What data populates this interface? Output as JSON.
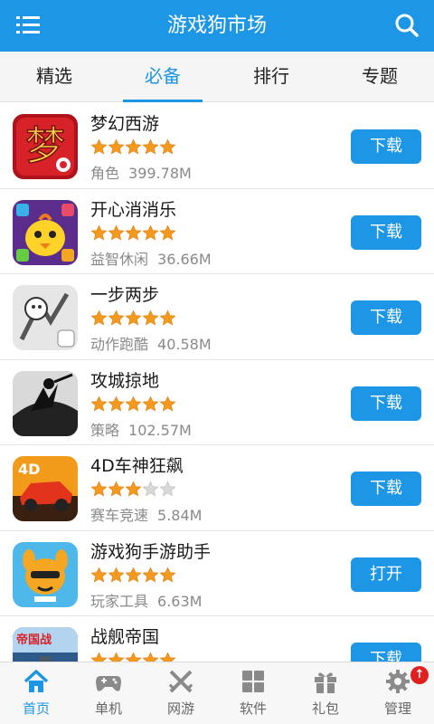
{
  "header": {
    "title": "游戏狗市场",
    "menu_icon": "menu-icon",
    "search_icon": "search-icon",
    "background": "#1e96e6"
  },
  "tabs": [
    {
      "label": "精选",
      "active": false
    },
    {
      "label": "必备",
      "active": true
    },
    {
      "label": "排行",
      "active": false
    },
    {
      "label": "专题",
      "active": false
    }
  ],
  "apps": [
    {
      "name": "梦幻西游",
      "rating": 5,
      "category": "角色",
      "size": "399.78M",
      "action": "下载",
      "icon": "menghuan-xiyou-icon"
    },
    {
      "name": "开心消消乐",
      "rating": 5,
      "category": "益智休闲",
      "size": "36.66M",
      "action": "下载",
      "icon": "kaixin-xiaoxiaole-icon"
    },
    {
      "name": "一步两步",
      "rating": 5,
      "category": "动作跑酷",
      "size": "40.58M",
      "action": "下载",
      "icon": "yibu-liangbu-icon"
    },
    {
      "name": "攻城掠地",
      "rating": 5,
      "category": "策略",
      "size": "102.57M",
      "action": "下载",
      "icon": "gongcheng-luedi-icon"
    },
    {
      "name": "4D车神狂飙",
      "rating": 3,
      "category": "赛车竞速",
      "size": "5.84M",
      "action": "下载",
      "icon": "4d-racing-icon"
    },
    {
      "name": "游戏狗手游助手",
      "rating": 5,
      "category": "玩家工具",
      "size": "6.63M",
      "action": "打开",
      "icon": "youxigou-assistant-icon"
    },
    {
      "name": "战舰帝国",
      "rating": 5,
      "category": "",
      "size": "",
      "action": "下载",
      "icon": "zhanjian-diguo-icon"
    }
  ],
  "bottom_nav": [
    {
      "label": "首页",
      "icon": "home-icon",
      "active": true
    },
    {
      "label": "单机",
      "icon": "gamepad-icon",
      "active": false
    },
    {
      "label": "网游",
      "icon": "crossed-swords-icon",
      "active": false
    },
    {
      "label": "软件",
      "icon": "grid-apps-icon",
      "active": false
    },
    {
      "label": "礼包",
      "icon": "gift-icon",
      "active": false
    },
    {
      "label": "管理",
      "icon": "gear-icon",
      "active": false,
      "badge": "↑"
    }
  ],
  "colors": {
    "accent": "#1e96e6",
    "star_filled": "#f39a1e",
    "star_empty": "#d8d8d8",
    "badge": "#e02020"
  }
}
